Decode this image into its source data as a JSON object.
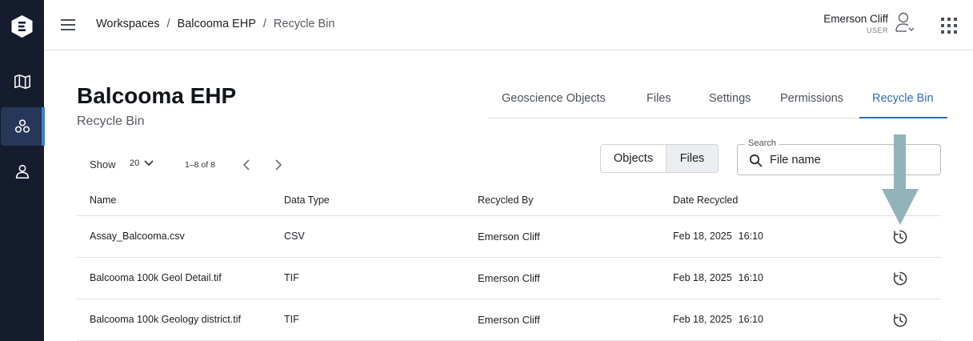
{
  "sidebar": {
    "logo_icon": "evo-logo-icon",
    "items": [
      {
        "name": "map",
        "icon": "map-icon",
        "active": false
      },
      {
        "name": "workspaces",
        "icon": "workspaces-icon",
        "active": true
      },
      {
        "name": "user",
        "icon": "user-icon",
        "active": false
      }
    ]
  },
  "header": {
    "menu_icon": "hamburger-icon",
    "breadcrumb": [
      "Workspaces",
      "Balcooma EHP",
      "Recycle Bin"
    ],
    "separator": "/",
    "user_name": "Emerson Cliff",
    "user_role": "USER",
    "apps_icon": "grid-apps-icon"
  },
  "page": {
    "title": "Balcooma EHP",
    "subtitle": "Recycle Bin"
  },
  "tabs": [
    {
      "label": "Geoscience Objects",
      "active": false
    },
    {
      "label": "Files",
      "active": false
    },
    {
      "label": "Settings",
      "active": false
    },
    {
      "label": "Permissions",
      "active": false
    },
    {
      "label": "Recycle Bin",
      "active": true
    }
  ],
  "toolbar": {
    "show_label": "Show",
    "page_size": "20",
    "range": "1–8 of 8",
    "toggle": {
      "objects": "Objects",
      "files": "Files",
      "selected": "Files"
    },
    "search": {
      "legend": "Search",
      "placeholder": "File name"
    }
  },
  "table": {
    "columns": [
      "Name",
      "Data Type",
      "Recycled By",
      "Date Recycled"
    ],
    "rows": [
      {
        "name": "Assay_Balcooma.csv",
        "type": "CSV",
        "by": "Emerson Cliff",
        "date": "Feb 18, 2025",
        "time": "16:10"
      },
      {
        "name": "Balcooma 100k Geol Detail.tif",
        "type": "TIF",
        "by": "Emerson Cliff",
        "date": "Feb 18, 2025",
        "time": "16:10"
      },
      {
        "name": "Balcooma 100k Geology district.tif",
        "type": "TIF",
        "by": "Emerson Cliff",
        "date": "Feb 18, 2025",
        "time": "16:10"
      }
    ]
  },
  "colors": {
    "sidebar": "#151c2e",
    "accent": "#2f6fb8",
    "annotation_arrow": "#93b3bb"
  }
}
